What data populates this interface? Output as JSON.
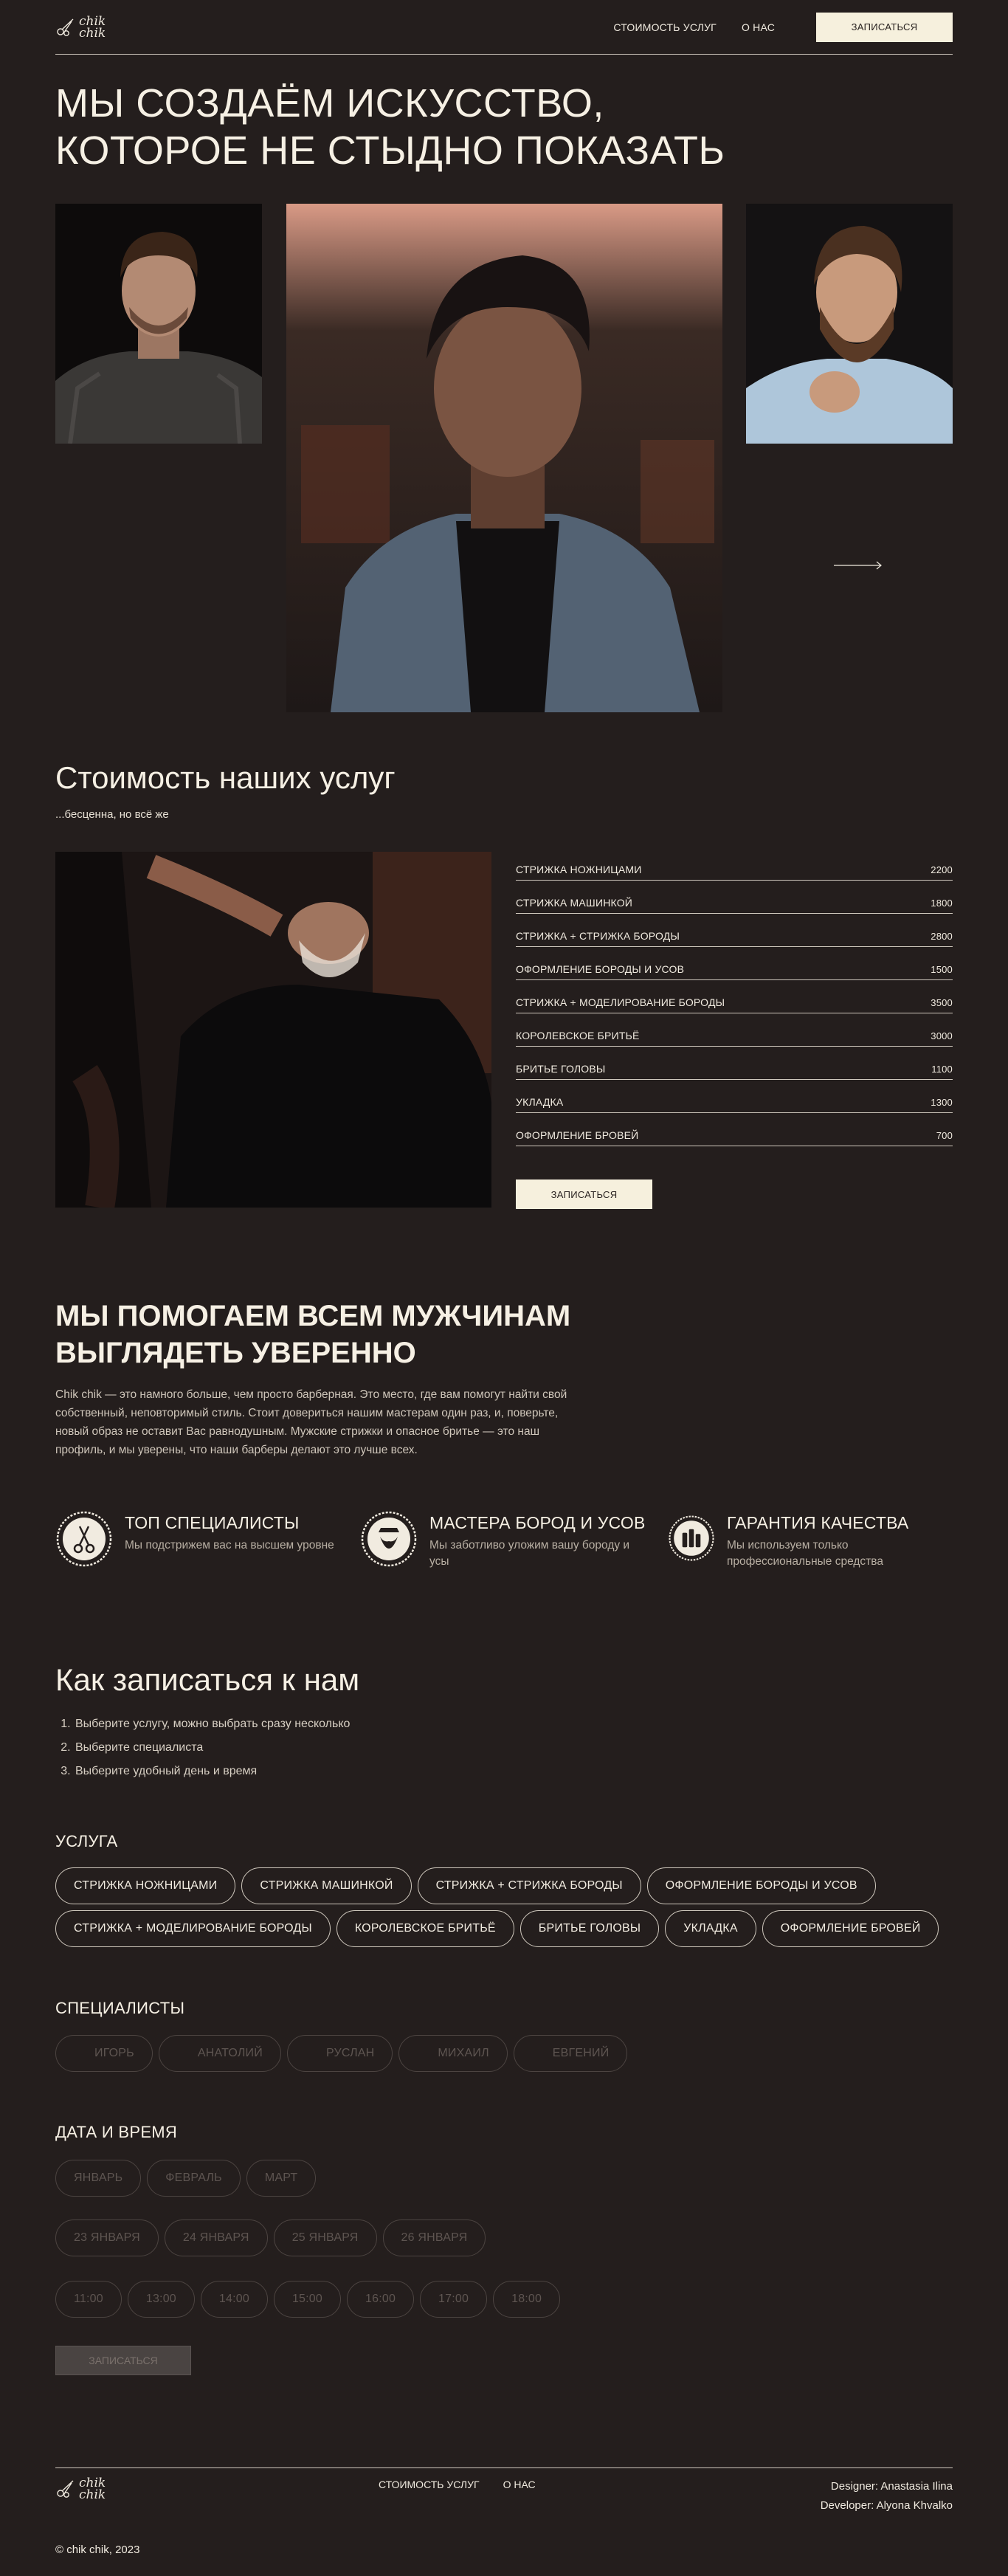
{
  "brand": {
    "line1": "chik",
    "line2": "chik"
  },
  "nav": {
    "prices": "СТОИМОСТЬ УСЛУГ",
    "about": "О НАС",
    "book": "ЗАПИСАТЬСЯ"
  },
  "hero": {
    "title_line1": "МЫ СОЗДАЁМ ИСКУССТВО,",
    "title_line2": "КОТОРОЕ НЕ СТЫДНО ПОКАЗАТЬ"
  },
  "prices": {
    "title": "Стоимость наших услуг",
    "subtitle": "...бесценна, но всё же",
    "items": [
      {
        "name": "СТРИЖКА НОЖНИЦАМИ",
        "price": "2200"
      },
      {
        "name": "СТРИЖКА МАШИНКОЙ",
        "price": "1800"
      },
      {
        "name": "СТРИЖКА + СТРИЖКА БОРОДЫ",
        "price": "2800"
      },
      {
        "name": "ОФОРМЛЕНИЕ БОРОДЫ И УСОВ",
        "price": "1500"
      },
      {
        "name": "СТРИЖКА + МОДЕЛИРОВАНИЕ БОРОДЫ",
        "price": "3500"
      },
      {
        "name": "КОРОЛЕВСКОЕ БРИТЬЁ",
        "price": "3000"
      },
      {
        "name": "БРИТЬЕ ГОЛОВЫ",
        "price": "1100"
      },
      {
        "name": "УКЛАДКА",
        "price": "1300"
      },
      {
        "name": "ОФОРМЛЕНИЕ БРОВЕЙ",
        "price": "700"
      }
    ],
    "button": "ЗАПИСАТЬСЯ"
  },
  "help": {
    "title_line1": "МЫ ПОМОГАЕМ ВСЕМ МУЖЧИНАМ",
    "title_line2": "ВЫГЛЯДЕТЬ УВЕРЕННО",
    "text": "Chik chik — это намного больше, чем просто барберная. Это место, где вам помогут найти свой собственный, неповторимый стиль. Стоит довериться нашим мастерам один раз, и, поверьте, новый образ не оставит Вас равнодушным. Мужские стрижки и опасное бритье — это наш профиль, и мы уверены, что наши барберы делают это лучше всех.",
    "features": [
      {
        "icon": "scissors-icon",
        "title": "ТОП СПЕЦИАЛИСТЫ",
        "desc": "Мы подстрижем вас на высшем уровне"
      },
      {
        "icon": "beard-icon",
        "title": "МАСТЕРА БОРОД И УСОВ",
        "desc": "Мы заботливо уложим вашу бороду и усы"
      },
      {
        "icon": "products-icon",
        "title": "ГАРАНТИЯ КАЧЕСТВА",
        "desc": "Мы используем только профессиональные средства"
      }
    ]
  },
  "booking": {
    "title": "Как записаться к нам",
    "steps": [
      "Выберите услугу, можно выбрать сразу несколько",
      "Выберите специалиста",
      "Выберите удобный день и время"
    ],
    "services_label": "УСЛУГА",
    "services": [
      "СТРИЖКА НОЖНИЦАМИ",
      "СТРИЖКА МАШИНКОЙ",
      "СТРИЖКА + СТРИЖКА БОРОДЫ",
      "ОФОРМЛЕНИЕ БОРОДЫ И УСОВ",
      "СТРИЖКА + МОДЕЛИРОВАНИЕ БОРОДЫ",
      "КОРОЛЕВСКОЕ БРИТЬЁ",
      "БРИТЬЕ ГОЛОВЫ",
      "УКЛАДКА",
      "ОФОРМЛЕНИЕ БРОВЕЙ"
    ],
    "specialists_label": "СПЕЦИАЛИСТЫ",
    "specialists": [
      "ИГОРЬ",
      "АНАТОЛИЙ",
      "РУСЛАН",
      "МИХАИЛ",
      "ЕВГЕНИЙ"
    ],
    "datetime_label": "ДАТА И ВРЕМЯ",
    "months": [
      "ЯНВАРЬ",
      "ФЕВРАЛЬ",
      "МАРТ"
    ],
    "dates": [
      "23 ЯНВАРЯ",
      "24 ЯНВАРЯ",
      "25 ЯНВАРЯ",
      "26 ЯНВАРЯ"
    ],
    "times": [
      "11:00",
      "13:00",
      "14:00",
      "15:00",
      "16:00",
      "17:00",
      "18:00"
    ],
    "submit": "ЗАПИСАТЬСЯ"
  },
  "footer": {
    "prices": "СТОИМОСТЬ УСЛУГ",
    "about": "О НАС",
    "designer": "Designer: Anastasia Ilina",
    "developer": "Developer: Alyona Khvalko",
    "copyright": "© chik chik, 2023"
  },
  "colors": {
    "background": "#241e1d",
    "text": "#f1ebe0",
    "button": "#f6f0dd",
    "line": "#cfc8bd"
  }
}
